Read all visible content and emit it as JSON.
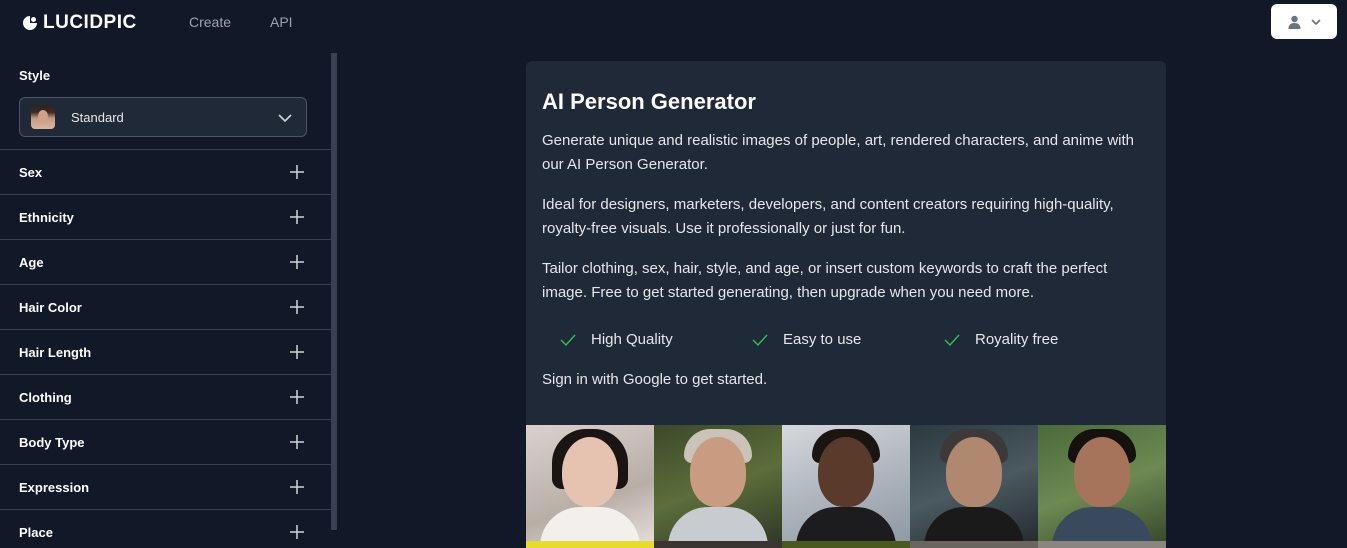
{
  "header": {
    "logo_text": "LUCIDPIC",
    "nav": [
      "Create",
      "API"
    ],
    "user_icon": "user-icon"
  },
  "sidebar": {
    "style_title": "Style",
    "style_value": "Standard",
    "facets": [
      "Sex",
      "Ethnicity",
      "Age",
      "Hair Color",
      "Hair Length",
      "Clothing",
      "Body Type",
      "Expression",
      "Place"
    ]
  },
  "card": {
    "title": "AI Person Generator",
    "paragraphs": [
      "Generate unique and realistic images of people, art, rendered characters, and anime with our AI Person Generator.",
      "Ideal for designers, marketers, developers, and content creators requiring high-quality, royalty-free visuals. Use it professionally or just for fun.",
      "Tailor clothing, sex, hair, style, and age, or insert custom keywords to craft the perfect image. Free to get started generating, then upgrade when you need more."
    ],
    "features": [
      "High Quality",
      "Easy to use",
      "Royality free"
    ],
    "signin": "Sign in with Google to get started."
  },
  "colors": {
    "background": "#111827",
    "panel": "#1f2937",
    "border": "#374151",
    "check": "#22c55e"
  }
}
